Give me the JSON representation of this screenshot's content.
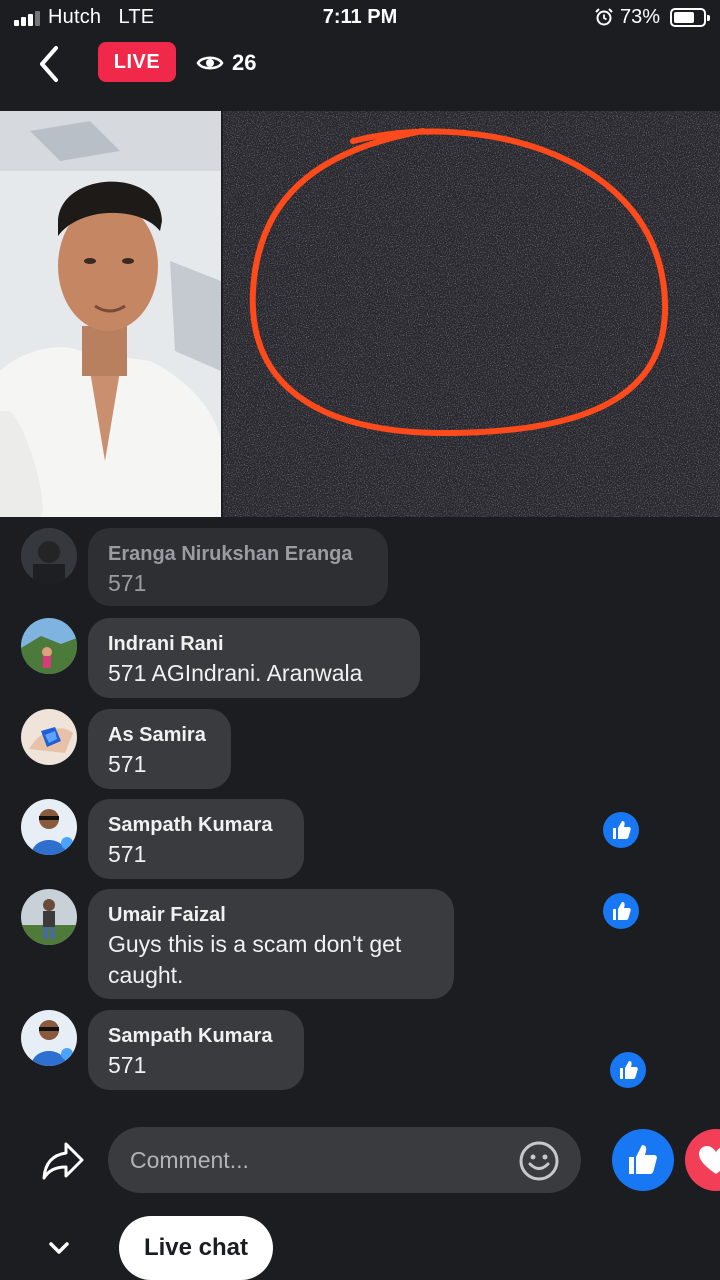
{
  "status_bar": {
    "carrier": "Hutch",
    "network": "LTE",
    "time": "7:11 PM",
    "battery_percent": "73%",
    "battery_level": 0.73,
    "icons": [
      "signal-icon",
      "alarm-icon",
      "battery-icon"
    ]
  },
  "header": {
    "back_icon": "chevron-left-icon",
    "live_label": "LIVE",
    "viewer_icon": "eye-icon",
    "viewer_count": "26"
  },
  "colors": {
    "background": "#1c1d21",
    "bubble": "#3a3b3f",
    "live_red": "#f02849",
    "like_blue": "#1877f2",
    "love_red": "#f33e58",
    "circle_orange": "#ff4a1c"
  },
  "comments": [
    {
      "name": "Eranga Nirukshan Eranga",
      "text": "571",
      "faded": true,
      "liked": false
    },
    {
      "name": "Indrani Rani",
      "text": "571  AGIndrani.   Aranwala",
      "faded": false,
      "liked": false
    },
    {
      "name": "As Samira",
      "text": "571",
      "faded": false,
      "liked": false
    },
    {
      "name": "Sampath Kumara",
      "text": "571",
      "faded": false,
      "liked": true
    },
    {
      "name": "Umair Faizal",
      "text_line1": "Guys this is a scam don't get",
      "text_line2": "caught.",
      "faded": false,
      "liked": true
    },
    {
      "name": "Sampath Kumara",
      "text": "571",
      "faded": false,
      "liked": true
    }
  ],
  "composer": {
    "share_icon": "share-icon",
    "placeholder": "Comment...",
    "emoji_icon": "smiley-icon",
    "like_icon": "thumbs-up-icon",
    "love_icon": "heart-icon"
  },
  "footer": {
    "collapse_icon": "chevron-down-icon",
    "live_chat_label": "Live chat"
  }
}
